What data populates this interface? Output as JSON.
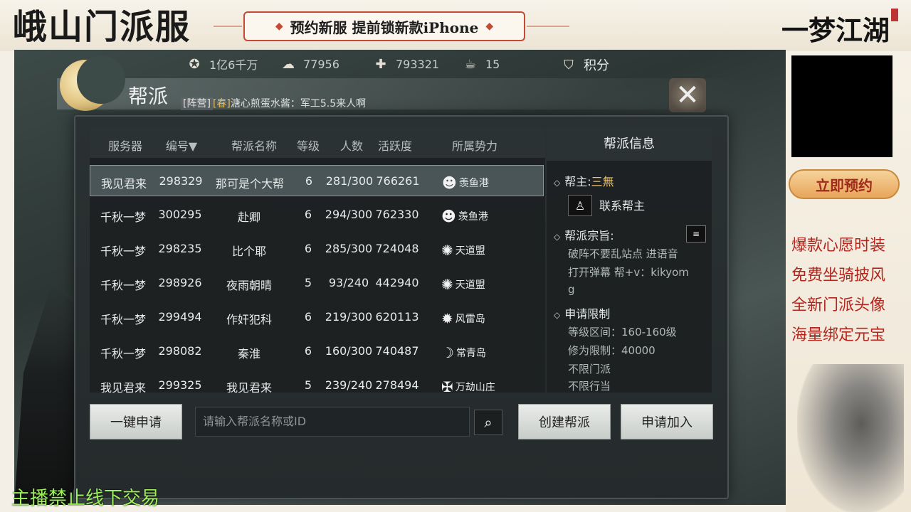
{
  "stream": {
    "brand_left": "峨山门派服",
    "promo_banner": "预约新服 提前锁新款iPhone",
    "brand_right": "一梦江湖",
    "reserve_button": "立即预约",
    "promo_lines": [
      "爆款心愿时装",
      "免费坐骑披风",
      "全新门派头像",
      "海量绑定元宝"
    ],
    "notice": "主播禁止线下交易"
  },
  "currencies": [
    {
      "icon": "reel-icon",
      "value": "1亿6千万"
    },
    {
      "icon": "silver-icon",
      "value": "77956"
    },
    {
      "icon": "jade-icon",
      "value": "793321"
    },
    {
      "icon": "bowl-icon",
      "value": "15"
    },
    {
      "icon": "shield-icon",
      "value": "积分"
    }
  ],
  "panel": {
    "title": "帮派",
    "chat_tag_camp": "[阵营]",
    "chat_tag_season": "[春]",
    "chat_text": "溏心煎蛋水酱：军工5.5来人啊"
  },
  "table": {
    "headers": [
      "服务器",
      "编号▼",
      "帮派名称",
      "等级",
      "人数",
      "活跃度",
      "所属势力"
    ],
    "rows": [
      {
        "server": "我见君来",
        "id": "298329",
        "name": "那可是个大帮",
        "level": "6",
        "members": "281/300",
        "activity": "766261",
        "faction": "羡鱼港"
      },
      {
        "server": "千秋一梦",
        "id": "300295",
        "name": "赴卿",
        "level": "6",
        "members": "294/300",
        "activity": "762330",
        "faction": "羡鱼港"
      },
      {
        "server": "千秋一梦",
        "id": "298235",
        "name": "比个耶",
        "level": "6",
        "members": "285/300",
        "activity": "724048",
        "faction": "天道盟"
      },
      {
        "server": "千秋一梦",
        "id": "298926",
        "name": "夜雨朝晴",
        "level": "5",
        "members": "93/240",
        "activity": "442940",
        "faction": "天道盟"
      },
      {
        "server": "千秋一梦",
        "id": "299494",
        "name": "作奸犯科",
        "level": "6",
        "members": "219/300",
        "activity": "620113",
        "faction": "风雷岛"
      },
      {
        "server": "千秋一梦",
        "id": "298082",
        "name": "秦淮",
        "level": "6",
        "members": "160/300",
        "activity": "740487",
        "faction": "常青岛"
      },
      {
        "server": "我见君来",
        "id": "299325",
        "name": "我见君来",
        "level": "5",
        "members": "239/240",
        "activity": "278494",
        "faction": "万劫山庄"
      }
    ]
  },
  "info": {
    "title": "帮派信息",
    "leader_label": "帮主:",
    "leader_name": "三無",
    "contact_label": "联系帮主",
    "purpose_label": "帮派宗旨:",
    "purpose_line1": "破阵不要乱站点 进语音",
    "purpose_line2": "打开弹幕 帮+v：kikyom",
    "purpose_line3": "g",
    "limit_label": "申请限制",
    "level_range": "等级区间：160-160级",
    "cultivation_limit": "修为限制：40000",
    "no_sect_limit": "不限门派",
    "no_camp_limit": "不限行当"
  },
  "controls": {
    "one_click_apply": "一键申请",
    "search_placeholder": "请输入帮派名称或ID",
    "create_guild": "创建帮派",
    "apply_join": "申请加入"
  }
}
